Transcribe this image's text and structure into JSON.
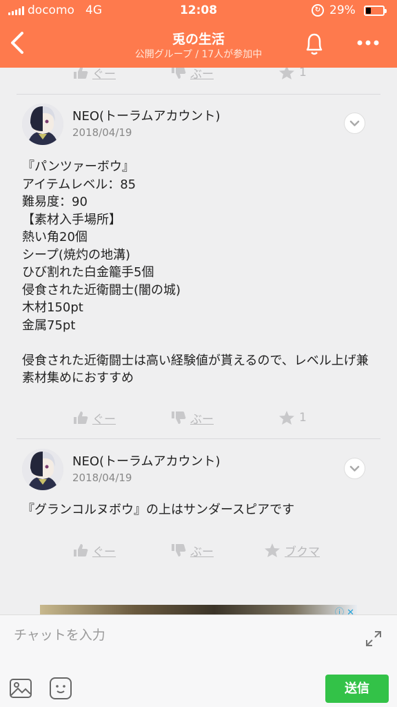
{
  "status_bar": {
    "carrier": "docomo",
    "network": "4G",
    "time": "12:08",
    "battery_percent": "29%",
    "battery_level": 0.29
  },
  "header": {
    "title": "兎の生活",
    "subtitle": "公開グループ / 17人が参加中",
    "accent_color": "#fe7a4d",
    "back_icon": "chevron-left-icon",
    "bell_icon": "bell-icon",
    "more_icon": "more-horizontal-icon"
  },
  "top_actions": {
    "like_label": "ぐー",
    "dislike_label": "ぶー",
    "star_count": "1"
  },
  "posts": [
    {
      "author": "NEO(トーラムアカウント)",
      "date": "2018/04/19",
      "body": "『パンツァーボウ』\nアイテムレベル：85\n難易度：90\n【素材入手場所】\n熱い角20個\nシープ(焼灼の地溝)\nひび割れた白金籠手5個\n侵食された近衛闘士(闇の城)\n木材150pt\n金属75pt\n\n侵食された近衛闘士は高い経験値が貰えるので、レベル上げ兼素材集めにおすすめ",
      "like_label": "ぐー",
      "dislike_label": "ぶー",
      "star_count": "1"
    },
    {
      "author": "NEO(トーラムアカウント)",
      "date": "2018/04/19",
      "body": "『グランコルヌボウ』の上はサンダースピアです",
      "like_label": "ぐー",
      "dislike_label": "ぶー",
      "bookmark_label": "ブクマ"
    }
  ],
  "composer": {
    "placeholder": "チャットを入力",
    "send_label": "送信",
    "send_color": "#33c248"
  }
}
